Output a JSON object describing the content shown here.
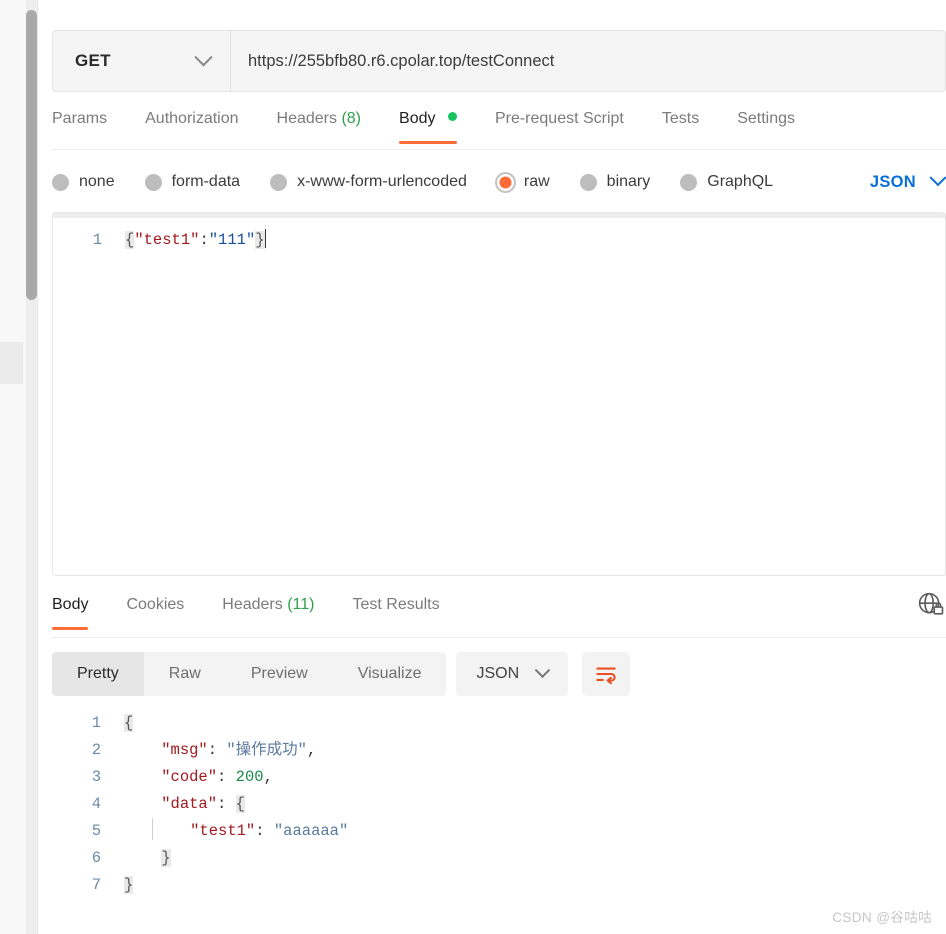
{
  "request": {
    "method": "GET",
    "url": "https://255bfb80.r6.cpolar.top/testConnect",
    "tabs": [
      {
        "label": "Params",
        "active": false
      },
      {
        "label": "Authorization",
        "active": false
      },
      {
        "label": "Headers",
        "count": "(8)",
        "active": false
      },
      {
        "label": "Body",
        "active": true,
        "dot": true
      },
      {
        "label": "Pre-request Script",
        "active": false
      },
      {
        "label": "Tests",
        "active": false
      },
      {
        "label": "Settings",
        "active": false
      }
    ],
    "body_types": [
      {
        "label": "none",
        "selected": false
      },
      {
        "label": "form-data",
        "selected": false
      },
      {
        "label": "x-www-form-urlencoded",
        "selected": false
      },
      {
        "label": "raw",
        "selected": true
      },
      {
        "label": "binary",
        "selected": false
      },
      {
        "label": "GraphQL",
        "selected": false
      }
    ],
    "format_label": "JSON",
    "editor": {
      "lines": [
        "1"
      ],
      "line1": {
        "open_brace": "{",
        "key": "\"test1\"",
        "colon": ":",
        "value": "\"111\"",
        "close_brace": "}"
      }
    }
  },
  "response": {
    "tabs": [
      {
        "label": "Body",
        "active": true
      },
      {
        "label": "Cookies",
        "active": false
      },
      {
        "label": "Headers",
        "count": "(11)",
        "active": false
      },
      {
        "label": "Test Results",
        "active": false
      }
    ],
    "view_modes": [
      {
        "label": "Pretty",
        "active": true
      },
      {
        "label": "Raw",
        "active": false
      },
      {
        "label": "Preview",
        "active": false
      },
      {
        "label": "Visualize",
        "active": false
      }
    ],
    "format_label": "JSON",
    "icons": {
      "globe_lock": "globe-lock-icon",
      "wrap_text": "wrap-text-icon"
    },
    "body": {
      "line_numbers": [
        "1",
        "2",
        "3",
        "4",
        "5",
        "6",
        "7"
      ],
      "l1": {
        "text": "{"
      },
      "l2": {
        "key": "\"msg\"",
        "colon": ":",
        "value": "\"操作成功\"",
        "comma": ","
      },
      "l3": {
        "key": "\"code\"",
        "colon": ":",
        "value": "200",
        "comma": ","
      },
      "l4": {
        "key": "\"data\"",
        "colon": ":",
        "brace": "{"
      },
      "l5": {
        "key": "\"test1\"",
        "colon": ":",
        "value": "\"aaaaaa\""
      },
      "l6": {
        "text": "}"
      },
      "l7": {
        "text": "}"
      }
    }
  },
  "watermark": "CSDN @谷咕咕",
  "colors": {
    "accent": "#ff6c37",
    "link": "#0b6fd8",
    "green": "#2fa14e",
    "json_key": "#a3191f",
    "json_string": "#1a4fa0",
    "json_number": "#1c8a4a"
  }
}
